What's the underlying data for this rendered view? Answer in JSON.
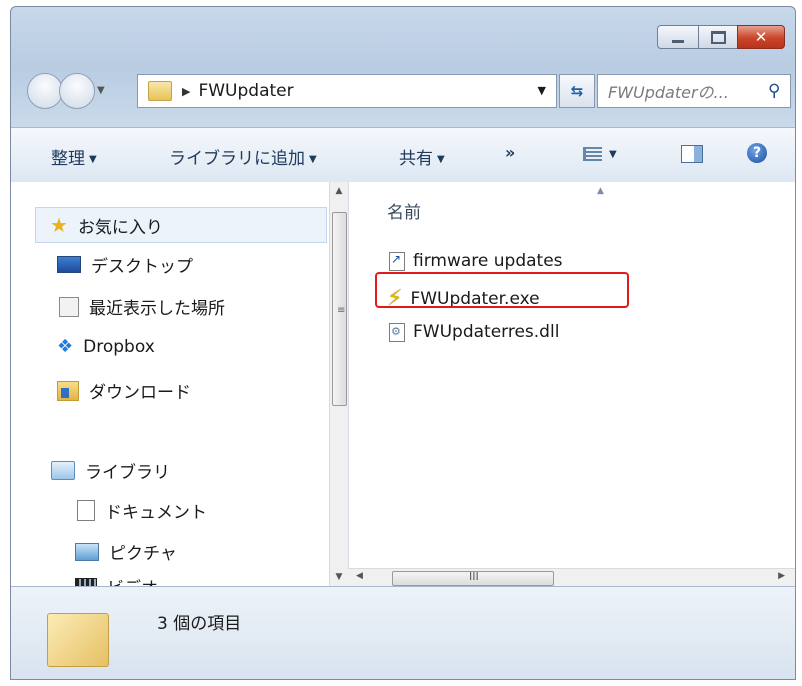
{
  "window": {
    "controls": {
      "minimize": "",
      "maximize": "",
      "close": "✕"
    }
  },
  "address": {
    "breadcrumb_folder": "FWUpdater",
    "search_placeholder": "FWUpdaterの..."
  },
  "toolbar": {
    "organize": "整理",
    "add_to_library": "ライブラリに追加",
    "share": "共有",
    "more": "»"
  },
  "nav": {
    "favorites": "お気に入り",
    "items": [
      {
        "label": "デスクトップ",
        "icon": "desktop-icon"
      },
      {
        "label": "最近表示した場所",
        "icon": "recent-places-icon"
      },
      {
        "label": "Dropbox",
        "icon": "dropbox-icon"
      },
      {
        "label": "ダウンロード",
        "icon": "downloads-icon"
      }
    ],
    "libraries": "ライブラリ",
    "library_items": [
      {
        "label": "ドキュメント",
        "icon": "documents-icon"
      },
      {
        "label": "ピクチャ",
        "icon": "pictures-icon"
      },
      {
        "label": "ビデオ",
        "icon": "videos-icon"
      }
    ]
  },
  "files": {
    "column_name": "名前",
    "items": [
      {
        "name": "firmware updates",
        "icon": "internet-shortcut-icon"
      },
      {
        "name": "FWUpdater.exe",
        "icon": "exe-lightning-icon",
        "highlighted": true
      },
      {
        "name": "FWUpdaterres.dll",
        "icon": "dll-file-icon"
      }
    ]
  },
  "status": {
    "item_count": "3 個の項目"
  },
  "colors": {
    "highlight_border": "#e31a1a",
    "close_button": "#c9452b"
  }
}
